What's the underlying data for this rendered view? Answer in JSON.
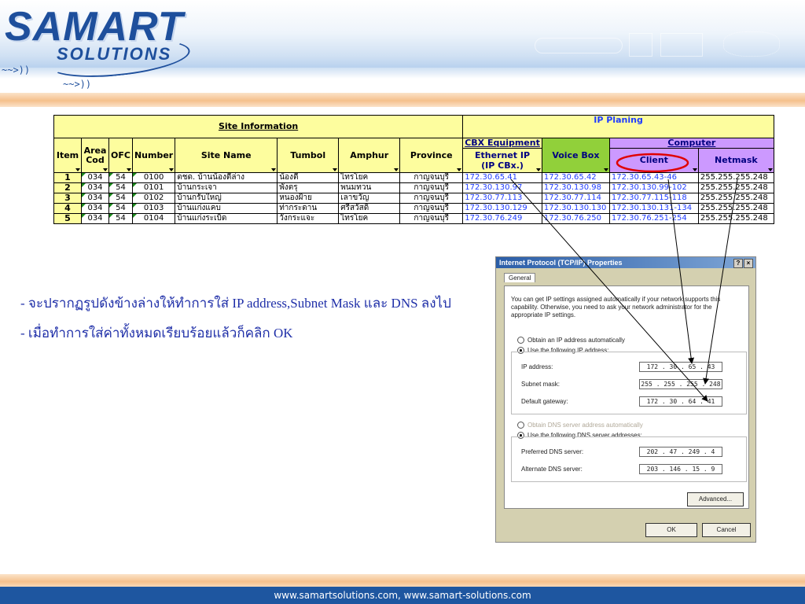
{
  "logo": {
    "name": "SAMART",
    "sub": "SOLUTIONS"
  },
  "sheet": {
    "site_info_title": "Site Information",
    "ip_title": "IP Planing",
    "cbx_group": "CBX Equipment",
    "computer_group": "Computer",
    "headers": {
      "item": "Item",
      "area1": "Area",
      "area2": "Cod",
      "ofc": "OFC",
      "number": "Number",
      "site_name": "Site Name",
      "tumbol": "Tumbol",
      "amphur": "Amphur",
      "province": "Province",
      "ethernet1": "Ethernet IP",
      "ethernet2": "(IP CBx.)",
      "voice_box": "Voice Box",
      "client": "Client",
      "netmask": "Netmask"
    },
    "rows": [
      {
        "item": "1",
        "area": "034",
        "ofc": "54",
        "number": "0100",
        "site": "ตชด. บ้านน้องตี้ล่าง",
        "tumbol": "น้องตี้",
        "amphur": "ไทรโยค",
        "province": "กาญจนบุรี",
        "ethernet": "172.30.65.41",
        "voice": "172.30.65.42",
        "client": "172.30.65.43-46",
        "netmask": "255.255.255.248"
      },
      {
        "item": "2",
        "area": "034",
        "ofc": "54",
        "number": "0101",
        "site": "บ้านกระเจา",
        "tumbol": "พังตรุ",
        "amphur": "พนมทวน",
        "province": "กาญจนบุรี",
        "ethernet": "172.30.130.97",
        "voice": "172.30.130.98",
        "client": "172.30.130.99-102",
        "netmask": "255.255.255.248"
      },
      {
        "item": "3",
        "area": "034",
        "ofc": "54",
        "number": "0102",
        "site": "บ้านกรับใหญ่",
        "tumbol": "หนองฝ้าย",
        "amphur": "เลาขวัญ",
        "province": "กาญจนบุรี",
        "ethernet": "172.30.77.113",
        "voice": "172.30.77.114",
        "client": "172.30.77.115-118",
        "netmask": "255.255.255.248"
      },
      {
        "item": "4",
        "area": "034",
        "ofc": "54",
        "number": "0103",
        "site": "บ้านแก่งแคบ",
        "tumbol": "ท่ากระดาน",
        "amphur": "ศรีสวัสดิ์",
        "province": "กาญจนบุรี",
        "ethernet": "172.30.130.129",
        "voice": "172.30.130.130",
        "client": "172.30.130.131-134",
        "netmask": "255.255.255.248"
      },
      {
        "item": "5",
        "area": "034",
        "ofc": "54",
        "number": "0104",
        "site": "บ้านแก่งระเบิด",
        "tumbol": "วังกระแจะ",
        "amphur": "ไทรโยค",
        "province": "กาญจนบุรี",
        "ethernet": "172.30.76.249",
        "voice": "172.30.76.250",
        "client": "172.30.76.251-254",
        "netmask": "255.255.255.248"
      }
    ]
  },
  "instructions": {
    "line1": "- จะปรากฏรูปดังข้างล่างให้ทำการใส่ IP address,Subnet Mask และ DNS ลงไป",
    "line2": "- เมื่อทำการใส่ค่าทั้งหมดเรียบร้อยแล้วก็คลิก OK"
  },
  "dialog": {
    "title": "Internet Protocol (TCP/IP) Properties",
    "help": "?",
    "close": "×",
    "tab": "General",
    "description": "You can get IP settings assigned automatically if your network supports this capability. Otherwise, you need to ask your network administrator for the appropriate IP settings.",
    "auto_ip": "Obtain an IP address automatically",
    "use_ip": "Use the following IP address:",
    "ip_label": "IP address:",
    "ip_value": "172 .  30 .  65 .  43",
    "mask_label": "Subnet mask:",
    "mask_value": "255 . 255 . 255 . 248",
    "gw_label": "Default gateway:",
    "gw_value": "172 .  30 .  64 .  41",
    "auto_dns": "Obtain DNS server address automatically",
    "use_dns": "Use the following DNS server addresses:",
    "pref_label": "Preferred DNS server:",
    "pref_value": "202 .  47 . 249 .  4",
    "alt_label": "Alternate DNS server:",
    "alt_value": "203 . 146 .  15 .  9",
    "advanced": "Advanced...",
    "ok": "OK",
    "cancel": "Cancel"
  },
  "footer": {
    "text": "www.samartsolutions.com,   www.samart-solutions.com"
  },
  "colors": {
    "brand": "#1e4f9c",
    "annotation_red": "#e00000",
    "sheet_yellow": "#fdfd9e",
    "sheet_green": "#91d03a",
    "sheet_purple": "#cc99ff"
  }
}
